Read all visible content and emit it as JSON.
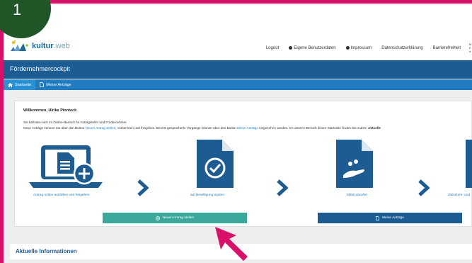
{
  "badge": {
    "number": "1"
  },
  "header": {
    "logo_text": "kultur",
    "logo_suffix": ".web",
    "nav": [
      "Logout",
      "Eigene Benutzerdaten",
      "Impressum",
      "Datenschutzerklärung",
      "Barrierefreiheit"
    ],
    "nav_icons": [
      "",
      "person-icon",
      "info-icon",
      "",
      ""
    ],
    "cutoff_letters": [
      "M",
      "E",
      "d"
    ]
  },
  "title_bar": {
    "title": "Fördernehmercockpit"
  },
  "nav_bar": {
    "items": [
      {
        "label": "Startseite",
        "icon": "home-icon"
      },
      {
        "label": "Meine Anträge",
        "icon": "document-icon"
      }
    ]
  },
  "main": {
    "welcome": "Willkommen, Ulrike Pionteck",
    "intro": "Sie befinden sich im Online-Bereich für Antragsteller und Fördernehmer.",
    "line_a": "Neue Anträge können Sie über den Button ",
    "link_new": "Neuen Antrag stellen",
    "line_b": ", vorbereiten und freigeben. Bereits gespeicherte Vorgänge können über den Button ",
    "link_mine": "Meine Anträge",
    "line_c": " eingesehen werden. Im unteren Bereich dieser Startseite finden Sie zudem ",
    "line_bold": "Aktuelle",
    "steps": [
      {
        "label": "Antrag online ausfüllen und freigeben",
        "icon": "laptop-document-add-icon"
      },
      {
        "label": "auf Bewilligung warten",
        "icon": "document-check-icon"
      },
      {
        "label": "Mittel abrufen",
        "icon": "document-coins-hand-icon"
      },
      {
        "label": "Zwischen- und",
        "icon": "document-icon"
      }
    ],
    "buttons": {
      "new_label": "Neuen Antrag stellen",
      "mine_label": "Meine Anträge"
    }
  },
  "news": {
    "title": "Aktuelle Informationen"
  },
  "colors": {
    "accent_pink": "#d8106a",
    "badge_green": "#1f5527",
    "header_blue": "#1c5c93",
    "nav_blue": "#1f7cc0",
    "teal": "#3aa89a"
  }
}
